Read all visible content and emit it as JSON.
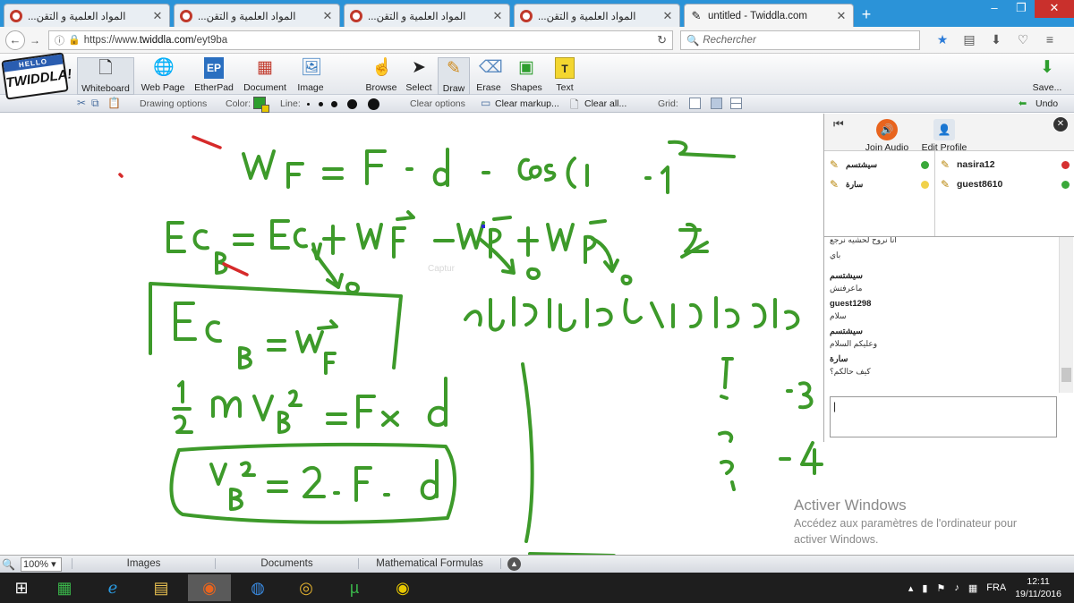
{
  "browser": {
    "tabs": [
      {
        "label": "...المواد العلمية و التقن",
        "active": false
      },
      {
        "label": "...المواد العلمية و التقن",
        "active": false
      },
      {
        "label": "...المواد العلمية و التقن",
        "active": false
      },
      {
        "label": "...المواد العلمية و التقن",
        "active": false
      },
      {
        "label": "untitled - Twiddla.com",
        "active": true
      }
    ],
    "url_prefix": "https://www.",
    "url_host": "twiddla.com",
    "url_path": "/eyt9ba",
    "search_placeholder": "Rechercher"
  },
  "logo": {
    "hello": "HELLO",
    "name": "TWIDDLA!"
  },
  "toolbar": {
    "whiteboard": "Whiteboard",
    "web_page": "Web Page",
    "etherpad": "EtherPad",
    "etherpad_icon_text": "EP",
    "document": "Document",
    "image": "Image",
    "browse": "Browse",
    "select": "Select",
    "draw": "Draw",
    "erase": "Erase",
    "shapes": "Shapes",
    "text": "Text",
    "text_icon_text": "T",
    "save": "Save..."
  },
  "options": {
    "drawing_options": "Drawing options",
    "color": "Color:",
    "line": "Line:",
    "clear_options": "Clear options",
    "clear_markup": "Clear markup...",
    "clear_all": "Clear all...",
    "grid": "Grid:",
    "undo": "Undo",
    "selected_color": "#2e9e2e"
  },
  "canvas": {
    "ghost_text": "Captur"
  },
  "panel": {
    "join_audio": "Join Audio",
    "edit_profile": "Edit Profile",
    "users_left": [
      {
        "name": "سيشتسم",
        "status_color": "#3aa83a"
      },
      {
        "name": "سارة",
        "status_color": "#f1d24a"
      }
    ],
    "users_right": [
      {
        "name": "nasira12",
        "status_color": "#d63030"
      },
      {
        "name": "guest8610",
        "status_color": "#3aa83a"
      }
    ],
    "chat": [
      {
        "who": "",
        "msg": "انا نروح لحشيه نرجع"
      },
      {
        "who": "",
        "msg": "باي"
      },
      {
        "who": "سيشتسم",
        "msg": "ماعرفتش"
      },
      {
        "who": "guest1298",
        "msg": "سلام"
      },
      {
        "who": "سيشتسم",
        "msg": "وعليكم السلام"
      },
      {
        "who": "سارة",
        "msg": "كيف حالكم؟"
      }
    ]
  },
  "watermark": {
    "title": "Activer Windows",
    "line1": "Accédez aux paramètres de l'ordinateur pour",
    "line2": "activer Windows."
  },
  "bottom": {
    "zoom": "100%",
    "images": "Images",
    "documents": "Documents",
    "math": "Mathematical Formulas"
  },
  "taskbar": {
    "lang": "FRA",
    "time": "12:11",
    "date": "19/11/2016"
  }
}
